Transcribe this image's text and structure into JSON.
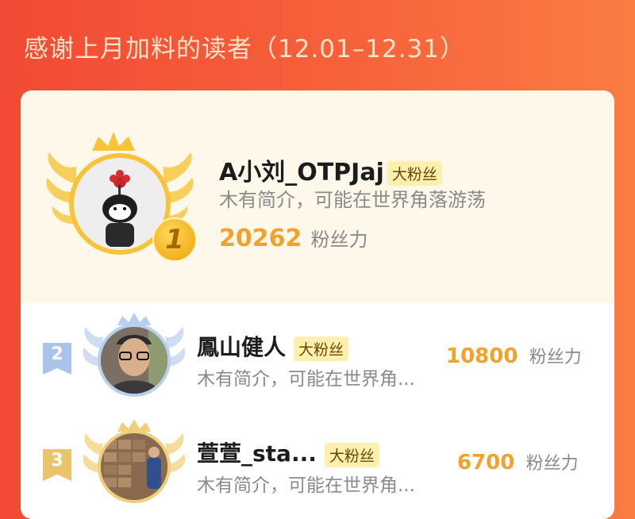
{
  "header": {
    "title": "感谢上月加料的读者（12.01–12.31）"
  },
  "first": {
    "rank": "1",
    "name": "A小刘_OTPJaj",
    "badge": "大粉丝",
    "bio": "木有简介，可能在世界角落游荡",
    "score": "20262",
    "score_unit": "粉丝力"
  },
  "rows": [
    {
      "rank": "2",
      "name": "鳳山健人",
      "badge": "大粉丝",
      "bio": "木有简介，可能在世界角...",
      "score": "10800",
      "score_unit": "粉丝力"
    },
    {
      "rank": "3",
      "name": "萱萱_sta...",
      "badge": "大粉丝",
      "bio": "木有简介，可能在世界角...",
      "score": "6700",
      "score_unit": "粉丝力"
    }
  ],
  "colors": {
    "background": "#f4553a",
    "gold": "#f2a22a",
    "silver": "#a9c4ea",
    "bronze": "#e8c46a"
  }
}
